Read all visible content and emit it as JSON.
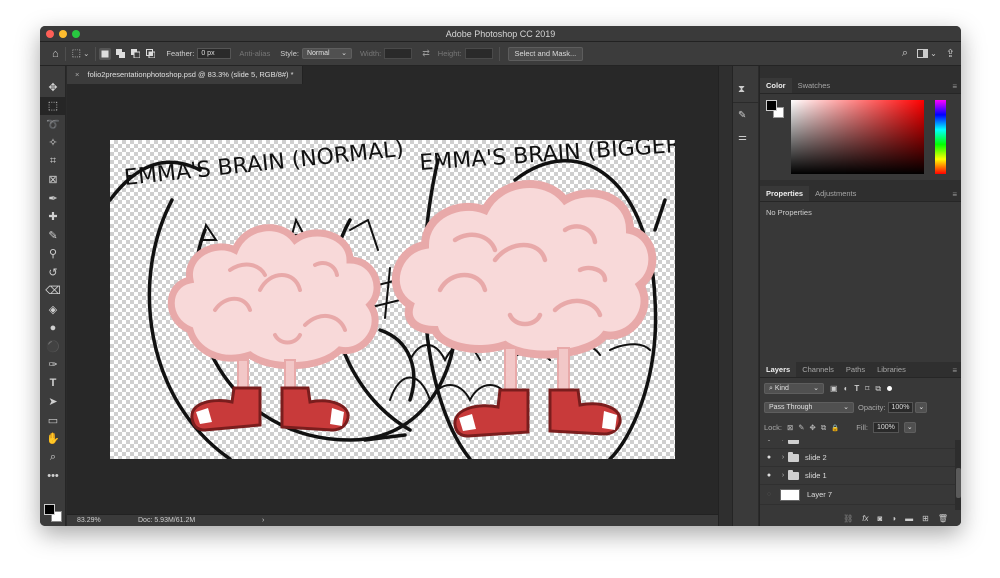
{
  "window": {
    "title": "Adobe Photoshop CC 2019"
  },
  "options_bar": {
    "feather_label": "Feather:",
    "feather_value": "0 px",
    "anti_alias_label": "Anti-alias",
    "style_label": "Style:",
    "style_value": "Normal",
    "width_label": "Width:",
    "height_label": "Height:",
    "select_mask_label": "Select and Mask..."
  },
  "icons": {
    "home": "⌂",
    "marquee": "⬚",
    "swap": "⇄",
    "search": "⌕",
    "share": "⇪",
    "close": "×",
    "eye": "●",
    "chevron": "›",
    "lock_pixels": "⊠",
    "lock_paint": "✎",
    "lock_move": "✥",
    "lock_artboard": "⧉",
    "lock_all": "🔒",
    "dropdown": "⌄"
  },
  "document": {
    "tab_title": "folio2presentationphotoshop.psd @ 83.3% (slide 5, RGB/8#) *",
    "close_icon": "×"
  },
  "status": {
    "zoom": "83.29%",
    "doc_info": "Doc: 5.93M/61.2M",
    "arrow": "›"
  },
  "tools": [
    {
      "name": "move-tool-icon",
      "glyph": "✥"
    },
    {
      "name": "marquee-tool-icon",
      "glyph": "⬚"
    },
    {
      "name": "lasso-tool-icon",
      "glyph": "➰"
    },
    {
      "name": "magic-wand-tool-icon",
      "glyph": "✧"
    },
    {
      "name": "crop-tool-icon",
      "glyph": "⌗"
    },
    {
      "name": "frame-tool-icon",
      "glyph": "⊠"
    },
    {
      "name": "eyedropper-tool-icon",
      "glyph": "✒"
    },
    {
      "name": "healing-brush-tool-icon",
      "glyph": "✚"
    },
    {
      "name": "brush-tool-icon",
      "glyph": "✎"
    },
    {
      "name": "clone-stamp-tool-icon",
      "glyph": "⚲"
    },
    {
      "name": "history-brush-tool-icon",
      "glyph": "↺"
    },
    {
      "name": "eraser-tool-icon",
      "glyph": "⌫"
    },
    {
      "name": "paint-bucket-tool-icon",
      "glyph": "◈"
    },
    {
      "name": "blur-tool-icon",
      "glyph": "●"
    },
    {
      "name": "dodge-tool-icon",
      "glyph": "⚫"
    },
    {
      "name": "pen-tool-icon",
      "glyph": "✑"
    },
    {
      "name": "type-tool-icon",
      "glyph": "T"
    },
    {
      "name": "path-selection-tool-icon",
      "glyph": "➤"
    },
    {
      "name": "rectangle-tool-icon",
      "glyph": "▭"
    },
    {
      "name": "hand-tool-icon",
      "glyph": "✋"
    },
    {
      "name": "zoom-tool-icon",
      "glyph": "⌕"
    },
    {
      "name": "more-tools-icon",
      "glyph": "•••"
    }
  ],
  "color_panel": {
    "tabs": [
      "Color",
      "Swatches"
    ],
    "colors": {
      "hue": "#ff0000",
      "foreground": "#000000",
      "background": "#ffffff"
    }
  },
  "properties_panel": {
    "tabs": [
      "Properties",
      "Adjustments"
    ],
    "empty_text": "No Properties"
  },
  "layers_panel": {
    "tabs": [
      "Layers",
      "Channels",
      "Paths",
      "Libraries"
    ],
    "kind_label": "Kind",
    "blend_mode": "Pass Through",
    "opacity_label": "Opacity:",
    "opacity_value": "100%",
    "lock_label": "Lock:",
    "fill_label": "Fill:",
    "fill_value": "100%",
    "layers": [
      {
        "name": "slide 2",
        "type": "group"
      },
      {
        "name": "slide 1",
        "type": "group"
      },
      {
        "name": "Layer 7",
        "type": "pixel"
      }
    ]
  },
  "artwork": {
    "caption_left": "EMMA'S BRAIN (NORMAL)",
    "caption_right": "EMMA'S BRAIN (BIGGER)",
    "colors": {
      "brain_fill": "#f8d9d9",
      "brain_outline": "#e8a9a9",
      "boot": "#c83a3a",
      "ink": "#111111"
    }
  }
}
